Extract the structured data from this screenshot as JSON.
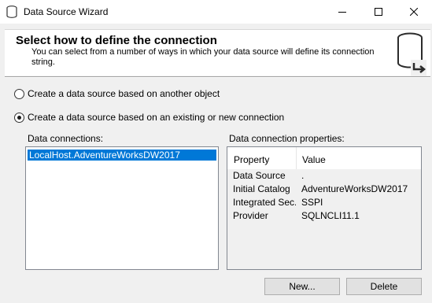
{
  "window": {
    "title": "Data Source Wizard",
    "controls": {
      "minimize_icon": "minimize-icon",
      "maximize_icon": "maximize-icon",
      "close_icon": "close-icon"
    }
  },
  "header": {
    "title": "Select how to define the connection",
    "description": "You can select from a number of ways in which your data source will define its connection string.",
    "icon": "database-arrow-icon"
  },
  "options": [
    {
      "label": "Create a data source based on another object",
      "selected": false
    },
    {
      "label": "Create a data source based on an existing or new connection",
      "selected": true
    }
  ],
  "connections": {
    "label": "Data connections:",
    "items": [
      {
        "label": "LocalHost.AdventureWorksDW2017",
        "selected": true
      }
    ]
  },
  "properties": {
    "label": "Data connection properties:",
    "columns": [
      "Property",
      "Value"
    ],
    "rows": [
      {
        "key": "Data Source",
        "value": "."
      },
      {
        "key": "Initial Catalog",
        "value": "AdventureWorksDW2017"
      },
      {
        "key": "Integrated Sec...",
        "value": "SSPI"
      },
      {
        "key": "Provider",
        "value": "SQLNCLI11.1"
      }
    ]
  },
  "buttons": {
    "new_label": "New...",
    "delete_label": "Delete"
  },
  "colors": {
    "selection": "#0078d7",
    "window_bg": "#f0f0f0",
    "button_bg": "#e1e1e1"
  }
}
